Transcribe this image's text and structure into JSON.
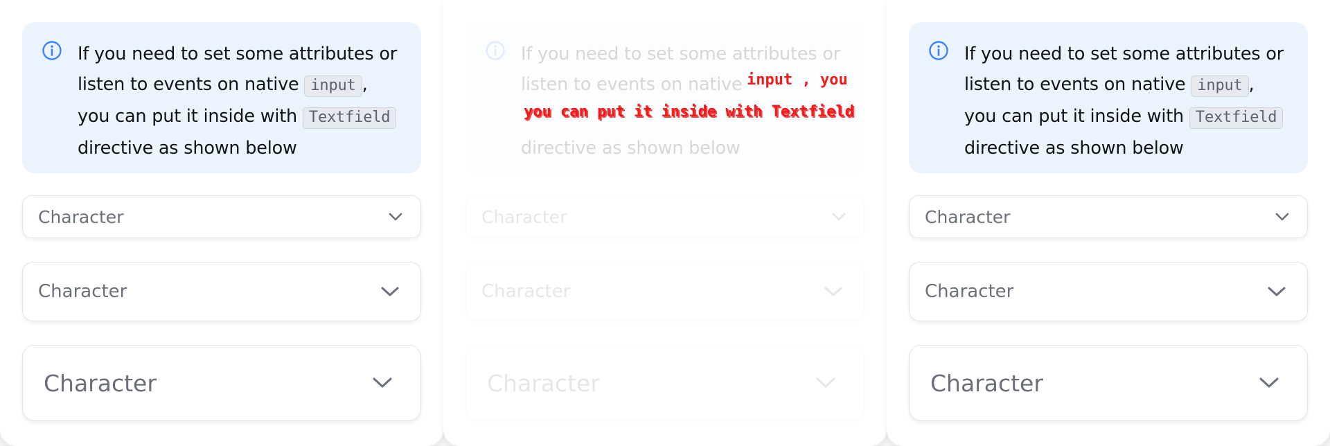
{
  "alert": {
    "text_before": "If you need to set some attributes or listen to events on native ",
    "code_input": "input",
    "text_middle": ", you can put it inside with ",
    "code_textfield": "Textfield",
    "text_after": " directive as shown below",
    "icon": "info-circle-icon",
    "icon_color": "#3b82f6",
    "background": "#ebf4fd"
  },
  "select_small": {
    "value": "Character",
    "icon": "chevron-down-icon"
  },
  "select_medium": {
    "value": "Character",
    "icon": "chevron-down-icon"
  },
  "select_large": {
    "value": "Character",
    "icon": "chevron-down-icon"
  },
  "ghost_overlay": {
    "line1": "input , you",
    "line2": "you can put it inside with Textfield",
    "color": "#ee1c1c"
  }
}
